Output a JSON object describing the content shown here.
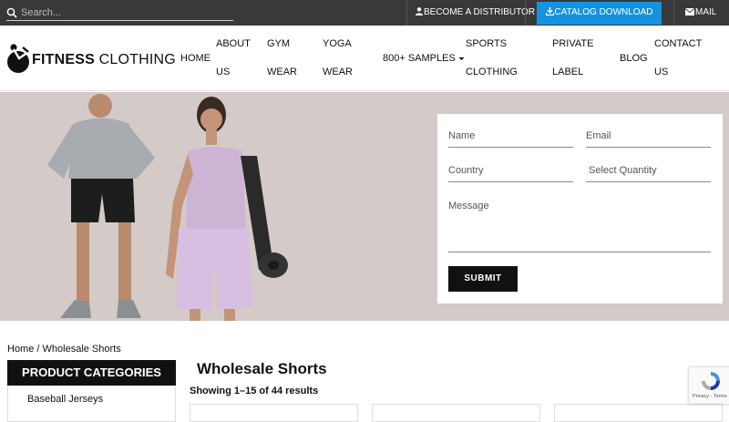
{
  "topbar": {
    "search_placeholder": "Search...",
    "distributor_label": "BECOME A DISTRIBUTOR",
    "catalog_label": "CATALOG DOWNLOAD",
    "mail_label": "MAIL US"
  },
  "header": {
    "logo_bold": "FITNESS",
    "logo_light": " CLOTHING",
    "nav": {
      "home": "HOME",
      "about_1": "ABOUT",
      "about_2": "US",
      "gym_1": "GYM",
      "gym_2": "WEAR",
      "yoga_1": "YOGA",
      "yoga_2": "WEAR",
      "samples": "800+ SAMPLES",
      "sports_1": "SPORTS",
      "sports_2": "CLOTHING",
      "private_1": "PRIVATE",
      "private_2": "LABEL",
      "blog": "BLOG",
      "contact_1": "CONTACT",
      "contact_2": "US"
    }
  },
  "form": {
    "name": "Name",
    "email": "Email",
    "country": "Country",
    "quantity": "Select Quantity",
    "message": "Message",
    "submit": "SUBMIT"
  },
  "breadcrumb": {
    "home": "Home",
    "sep": " / ",
    "current": "Wholesale Shorts"
  },
  "sidebar": {
    "heading": "PRODUCT CATEGORIES",
    "items": [
      "Baseball Jerseys"
    ]
  },
  "main": {
    "title": "Wholesale Shorts",
    "results": "Showing 1–15 of 44 results"
  },
  "recaptcha": {
    "footer": "Privacy - Terms"
  },
  "colors": {
    "topbar": "#393939",
    "accent": "#1593de",
    "hero_bg": "#d4cbc8",
    "dark": "#111111"
  }
}
